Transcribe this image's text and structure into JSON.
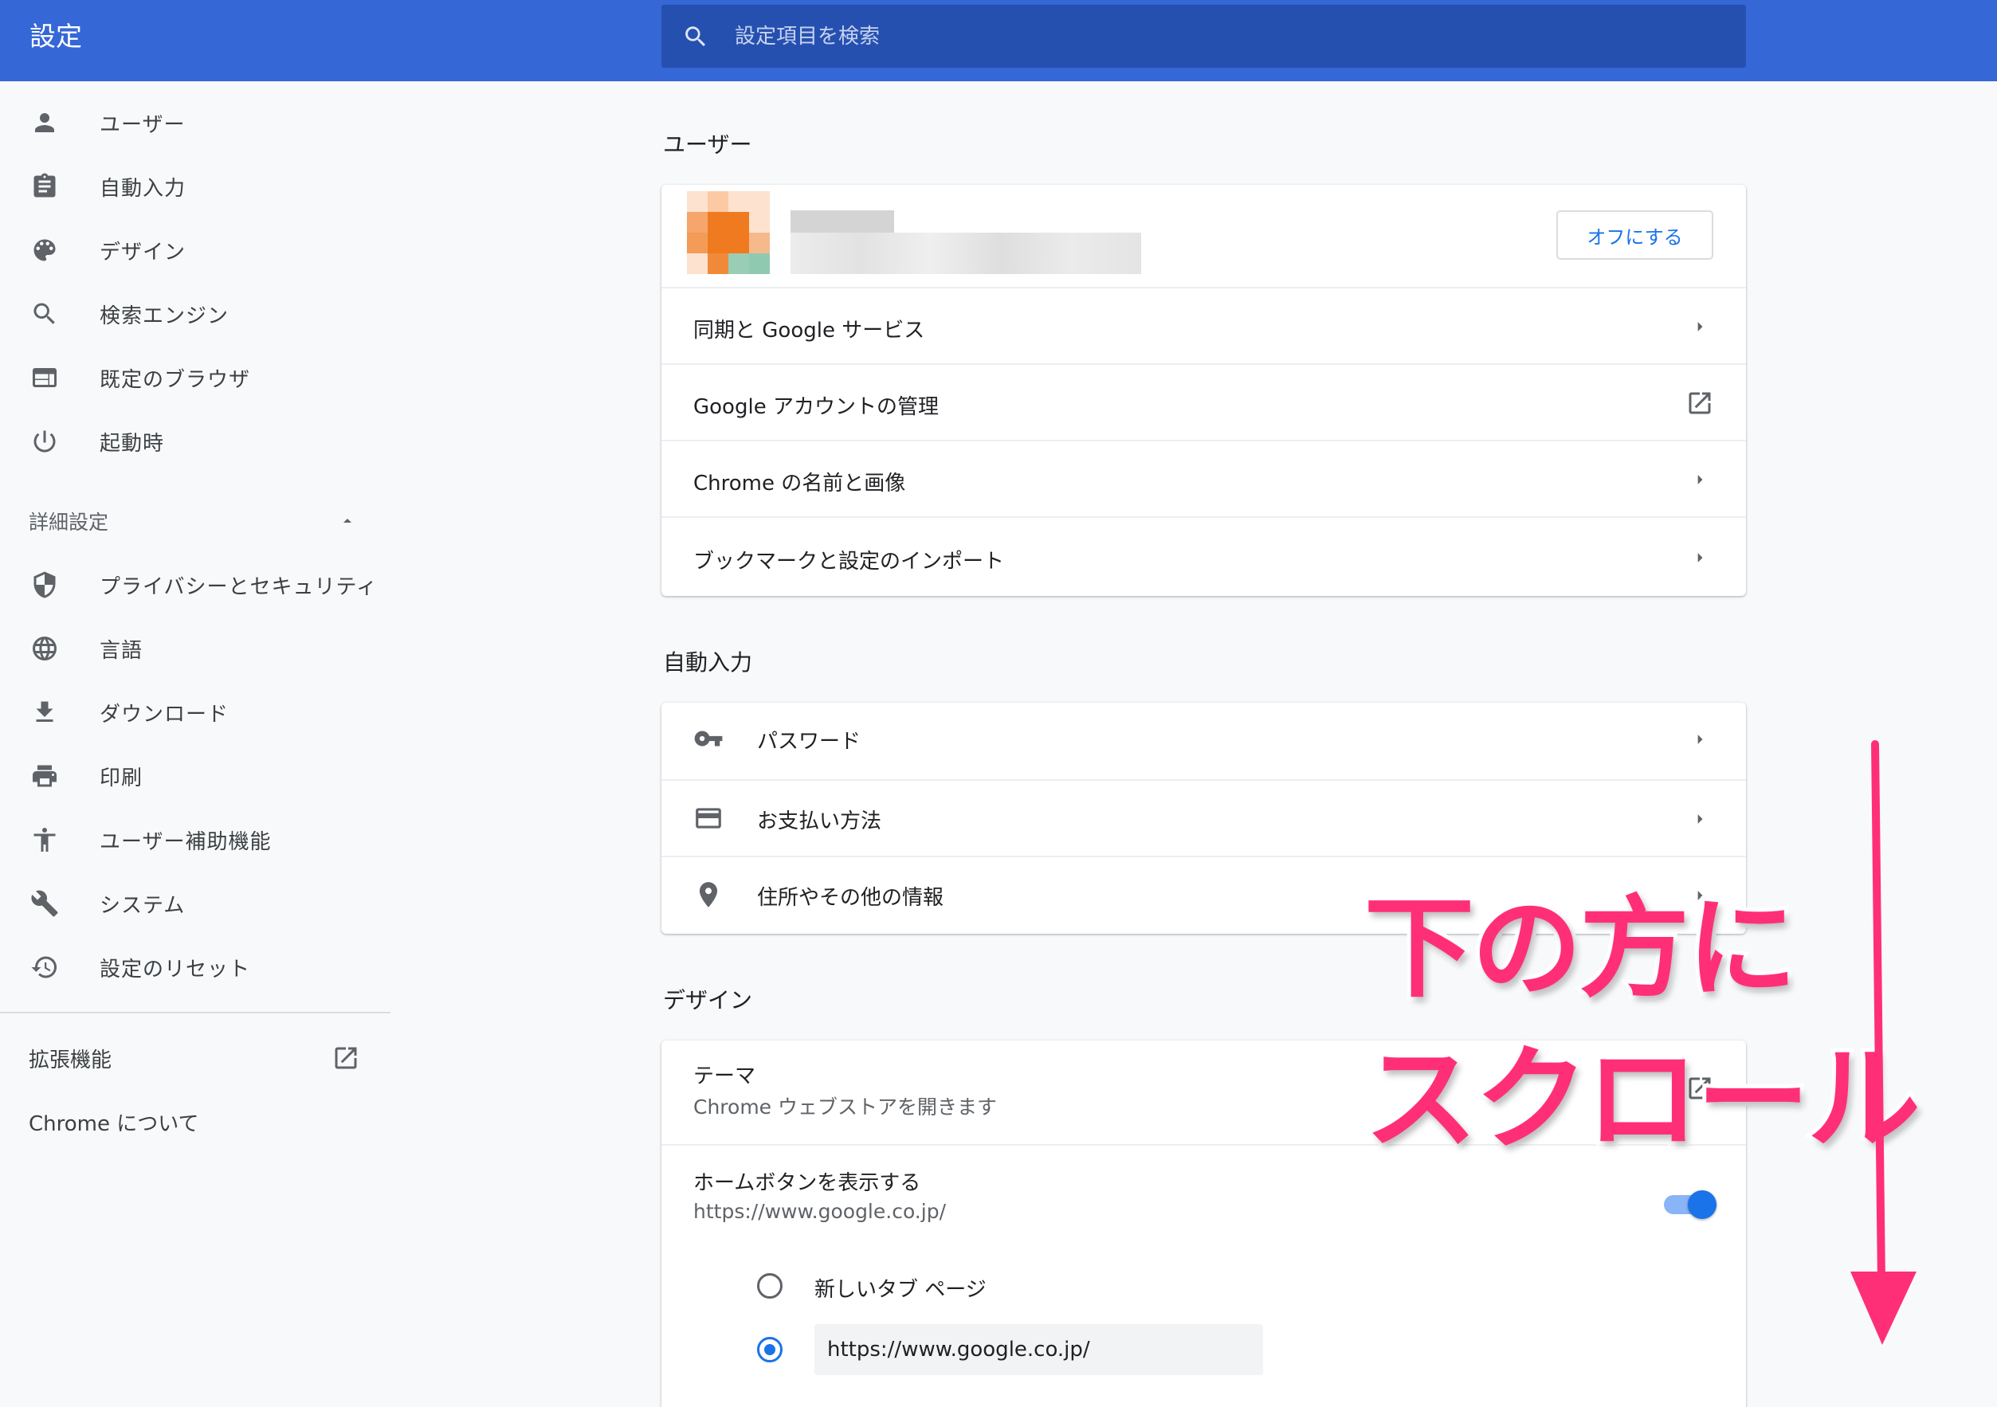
{
  "app": {
    "title": "設定"
  },
  "search": {
    "placeholder": "設定項目を検索"
  },
  "sidebar": {
    "items": [
      {
        "label": "ユーザー",
        "icon": "person-icon"
      },
      {
        "label": "自動入力",
        "icon": "clipboard-icon"
      },
      {
        "label": "デザイン",
        "icon": "palette-icon"
      },
      {
        "label": "検索エンジン",
        "icon": "search-icon"
      },
      {
        "label": "既定のブラウザ",
        "icon": "browser-icon"
      },
      {
        "label": "起動時",
        "icon": "power-icon"
      }
    ],
    "advanced": {
      "label": "詳細設定",
      "icon": "arrow-up-icon"
    },
    "advanced_items": [
      {
        "label": "プライバシーとセキュリティ",
        "icon": "shield-icon"
      },
      {
        "label": "言語",
        "icon": "globe-icon"
      },
      {
        "label": "ダウンロード",
        "icon": "download-icon"
      },
      {
        "label": "印刷",
        "icon": "printer-icon"
      },
      {
        "label": "ユーザー補助機能",
        "icon": "accessibility-icon"
      },
      {
        "label": "システム",
        "icon": "wrench-icon"
      },
      {
        "label": "設定のリセット",
        "icon": "history-icon"
      }
    ],
    "extensions": {
      "label": "拡張機能",
      "icon": "open-in-new-icon"
    },
    "about": {
      "label": "Chrome について"
    }
  },
  "main": {
    "user_section": {
      "title": "ユーザー",
      "off_button": "オフにする",
      "rows": [
        {
          "label": "同期と Google サービス",
          "icon": "arrow-right-icon"
        },
        {
          "label": "Google アカウントの管理",
          "icon": "open-in-new-icon"
        },
        {
          "label": "Chrome の名前と画像",
          "icon": "arrow-right-icon"
        },
        {
          "label": "ブックマークと設定のインポート",
          "icon": "arrow-right-icon"
        }
      ]
    },
    "autofill_section": {
      "title": "自動入力",
      "rows": [
        {
          "label": "パスワード",
          "icon": "key-icon"
        },
        {
          "label": "お支払い方法",
          "icon": "credit-card-icon"
        },
        {
          "label": "住所やその他の情報",
          "icon": "location-pin-icon"
        }
      ]
    },
    "design_section": {
      "title": "デザイン",
      "theme": {
        "label": "テーマ",
        "sub": "Chrome ウェブストアを開きます"
      },
      "home_button": {
        "label": "ホームボタンを表示する",
        "sub": "https://www.google.co.jp/",
        "enabled": true
      },
      "radio_new_tab": {
        "label": "新しいタブ ページ",
        "selected": false
      },
      "radio_custom": {
        "value": "https://www.google.co.jp/",
        "selected": true
      }
    }
  },
  "overlay": {
    "line1": "下の方に",
    "line2": "スクロール",
    "color": "#ff2f77"
  },
  "colors": {
    "header": "#3567d6",
    "search": "#2650b0",
    "accent": "#1a73e8"
  }
}
